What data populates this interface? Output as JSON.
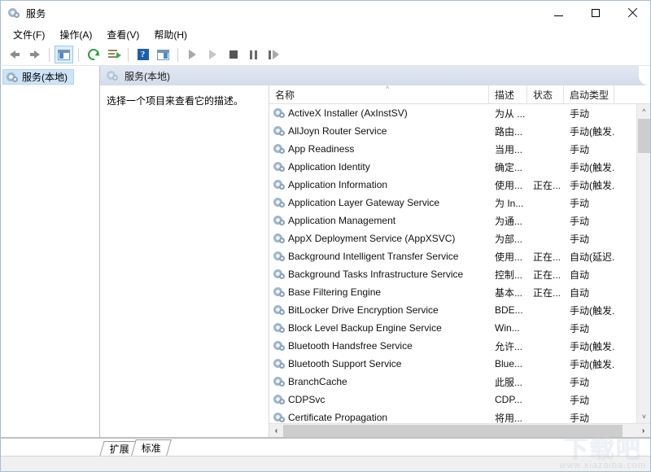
{
  "window": {
    "title": "服务",
    "title_icon": "services-gear-icon",
    "caption": {
      "minimize": "minimize-icon",
      "maximize": "maximize-icon",
      "close": "close-icon"
    }
  },
  "menubar": {
    "items": [
      {
        "label": "文件(F)",
        "name": "menu-file"
      },
      {
        "label": "操作(A)",
        "name": "menu-action"
      },
      {
        "label": "查看(V)",
        "name": "menu-view"
      },
      {
        "label": "帮助(H)",
        "name": "menu-help"
      }
    ]
  },
  "toolbar": {
    "buttons": [
      {
        "name": "back-button",
        "icon": "arrow-left-icon"
      },
      {
        "name": "forward-button",
        "icon": "arrow-right-icon"
      },
      {
        "name": "show-hide-console-tree-button",
        "icon": "console-tree-icon"
      },
      {
        "name": "refresh-button",
        "icon": "refresh-icon"
      },
      {
        "name": "export-list-button",
        "icon": "export-list-icon"
      },
      {
        "name": "help-button",
        "icon": "help-icon"
      },
      {
        "name": "properties-button",
        "icon": "properties-window-icon"
      },
      {
        "name": "start-service-button",
        "icon": "play-icon"
      },
      {
        "name": "resume-service-button",
        "icon": "play-dim-icon"
      },
      {
        "name": "stop-service-button",
        "icon": "stop-icon"
      },
      {
        "name": "pause-service-button",
        "icon": "pause-icon"
      },
      {
        "name": "restart-service-button",
        "icon": "restart-icon"
      }
    ]
  },
  "tree": {
    "items": [
      {
        "label": "服务(本地)",
        "icon": "services-gear-icon",
        "selected": true
      }
    ]
  },
  "pane": {
    "header_title": "服务(本地)",
    "header_icon": "services-gear-icon",
    "description_placeholder": "选择一个项目来查看它的描述。"
  },
  "list": {
    "columns": [
      {
        "key": "name",
        "label": "名称",
        "sorted": "asc"
      },
      {
        "key": "desc",
        "label": "描述"
      },
      {
        "key": "status",
        "label": "状态"
      },
      {
        "key": "start",
        "label": "启动类型"
      }
    ],
    "rows": [
      {
        "name": "ActiveX Installer (AxInstSV)",
        "desc": "为从 ...",
        "status": "",
        "start": "手动"
      },
      {
        "name": "AllJoyn Router Service",
        "desc": "路由...",
        "status": "",
        "start": "手动(触发..."
      },
      {
        "name": "App Readiness",
        "desc": "当用...",
        "status": "",
        "start": "手动"
      },
      {
        "name": "Application Identity",
        "desc": "确定...",
        "status": "",
        "start": "手动(触发..."
      },
      {
        "name": "Application Information",
        "desc": "使用...",
        "status": "正在...",
        "start": "手动(触发..."
      },
      {
        "name": "Application Layer Gateway Service",
        "desc": "为 In...",
        "status": "",
        "start": "手动"
      },
      {
        "name": "Application Management",
        "desc": "为通...",
        "status": "",
        "start": "手动"
      },
      {
        "name": "AppX Deployment Service (AppXSVC)",
        "desc": "为部...",
        "status": "",
        "start": "手动"
      },
      {
        "name": "Background Intelligent Transfer Service",
        "desc": "使用...",
        "status": "正在...",
        "start": "自动(延迟..."
      },
      {
        "name": "Background Tasks Infrastructure Service",
        "desc": "控制...",
        "status": "正在...",
        "start": "自动"
      },
      {
        "name": "Base Filtering Engine",
        "desc": "基本...",
        "status": "正在...",
        "start": "自动"
      },
      {
        "name": "BitLocker Drive Encryption Service",
        "desc": "BDE...",
        "status": "",
        "start": "手动(触发..."
      },
      {
        "name": "Block Level Backup Engine Service",
        "desc": "Win...",
        "status": "",
        "start": "手动"
      },
      {
        "name": "Bluetooth Handsfree Service",
        "desc": "允许...",
        "status": "",
        "start": "手动(触发..."
      },
      {
        "name": "Bluetooth Support Service",
        "desc": "Blue...",
        "status": "",
        "start": "手动(触发..."
      },
      {
        "name": "BranchCache",
        "desc": "此服...",
        "status": "",
        "start": "手动"
      },
      {
        "name": "CDPSvc",
        "desc": "CDP...",
        "status": "",
        "start": "手动"
      },
      {
        "name": "Certificate Propagation",
        "desc": "将用...",
        "status": "",
        "start": "手动"
      }
    ],
    "scroll": {
      "up_arrow": "chevron-up-icon",
      "down_arrow": "chevron-down-icon",
      "left_arrow": "chevron-left-icon",
      "right_arrow": "chevron-right-icon"
    }
  },
  "tabs": [
    {
      "label": "扩展",
      "active": false
    },
    {
      "label": "标准",
      "active": true
    }
  ],
  "watermark": {
    "text": "下载吧",
    "url": "www.xiazaiba.com"
  },
  "colors": {
    "accent": "#4d8ac9",
    "selection": "#cde4f7",
    "pane_header_top": "#e3e9f3",
    "pane_header_bottom": "#d3dceb",
    "window_border": "#a8bcd0"
  }
}
